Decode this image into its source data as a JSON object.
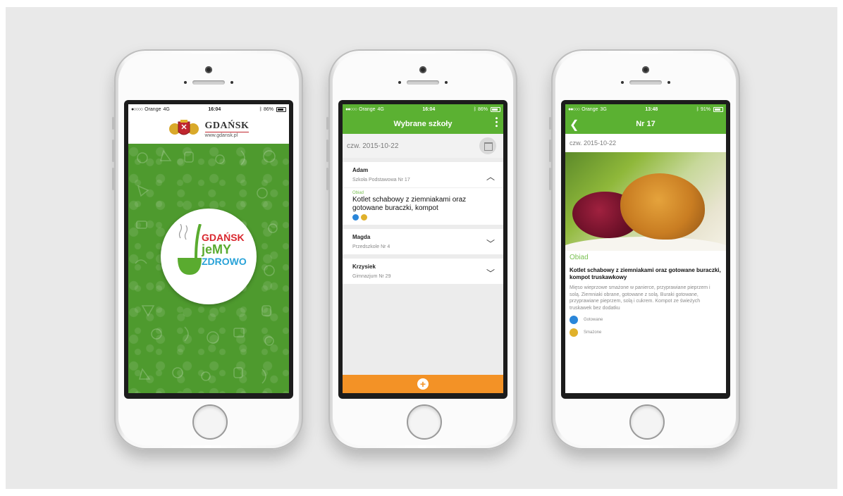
{
  "colors": {
    "green": "#5bb132",
    "orange": "#f39226",
    "blue_tag": "#2a86d9",
    "yellow_tag": "#e0b12b",
    "logo_red": "#d9272e",
    "logo_green": "#5aab2f",
    "logo_blue": "#2aa3d8"
  },
  "phone1": {
    "status": {
      "carrier": "Orange",
      "network": "4G",
      "time": "16:04",
      "battery": "86%"
    },
    "header": {
      "title": "GDAŃSK",
      "url": "www.gdansk.pl"
    },
    "logo": {
      "line1": "GDAŃSK",
      "line2": "jeMY",
      "line3": "ZDROWO"
    }
  },
  "phone2": {
    "status": {
      "carrier": "Orange",
      "network": "4G",
      "time": "16:04",
      "battery": "86%"
    },
    "title": "Wybrane szkoły",
    "date": "czw. 2015-10-22",
    "children": [
      {
        "name": "Adam",
        "school": "Szkoła Podstawowa Nr 17",
        "expanded": true,
        "meal_label": "Obiad",
        "meal": "Kotlet schabowy z ziemniakami oraz gotowane buraczki, kompot"
      },
      {
        "name": "Magda",
        "school": "Przedszkole Nr 4",
        "expanded": false
      },
      {
        "name": "Krzysiek",
        "school": "Gimnazjum Nr 29",
        "expanded": false
      }
    ],
    "add_icon": "plus-icon"
  },
  "phone3": {
    "status": {
      "carrier": "Orange",
      "network": "3G",
      "time": "13:48",
      "battery": "91%"
    },
    "title": "Nr 17",
    "date": "czw. 2015-10-22",
    "meal_label": "Obiad",
    "meal_title": "Kotlet schabowy z ziemniakami oraz gotowane buraczki, kompot truskawkowy",
    "description": "Mięso wieprzowe smażone w panierce, przyprawiane pieprzem i solą. Ziemniaki obrane, gotowane z solą. Buraki gotowane, przyprawiane pieprzem, solą i cukrem. Kompot ze świeżych truskawek bez dodatku",
    "preparation": [
      {
        "label": "Gotowane",
        "icon": "pot-icon"
      },
      {
        "label": "Smażone",
        "icon": "pan-icon"
      }
    ]
  }
}
